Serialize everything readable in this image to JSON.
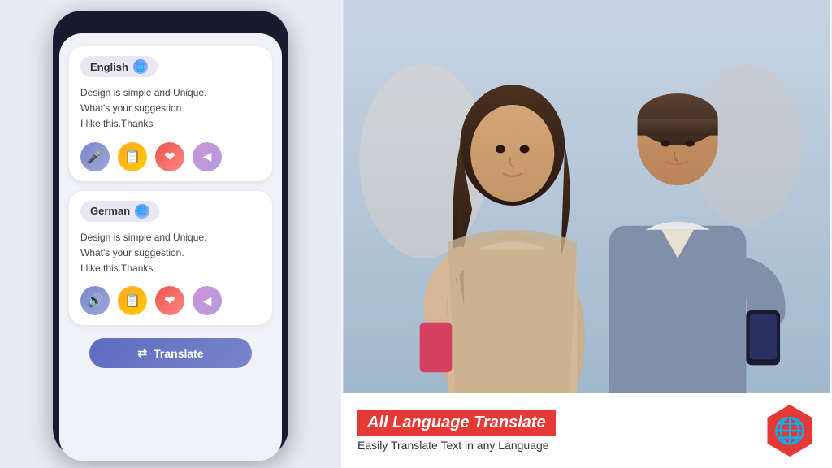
{
  "left_panel": {
    "background_color": "#e8eaf6"
  },
  "phone": {
    "source_card": {
      "language": "English",
      "text_line1": "Design is simple and Unique.",
      "text_line2": "What's your suggestion.",
      "text_line3": "I like this.Thanks",
      "actions": [
        "microphone",
        "copy",
        "heart",
        "share"
      ]
    },
    "target_card": {
      "language": "German",
      "text_line1": "Design is simple and Unique.",
      "text_line2": "What's your suggestion.",
      "text_line3": "I like this.Thanks",
      "actions": [
        "speaker",
        "copy",
        "heart",
        "share"
      ]
    },
    "translate_button": "Translate"
  },
  "right_panel": {
    "banner": {
      "title": "All Language Translate",
      "subtitle": "Easily Translate Text in any  Language"
    }
  },
  "icons": {
    "mic": "🎤",
    "copy": "📋",
    "heart": "❤",
    "share": "◀",
    "speaker": "🔊",
    "translate_icon": "⇄",
    "globe": "🌐"
  }
}
